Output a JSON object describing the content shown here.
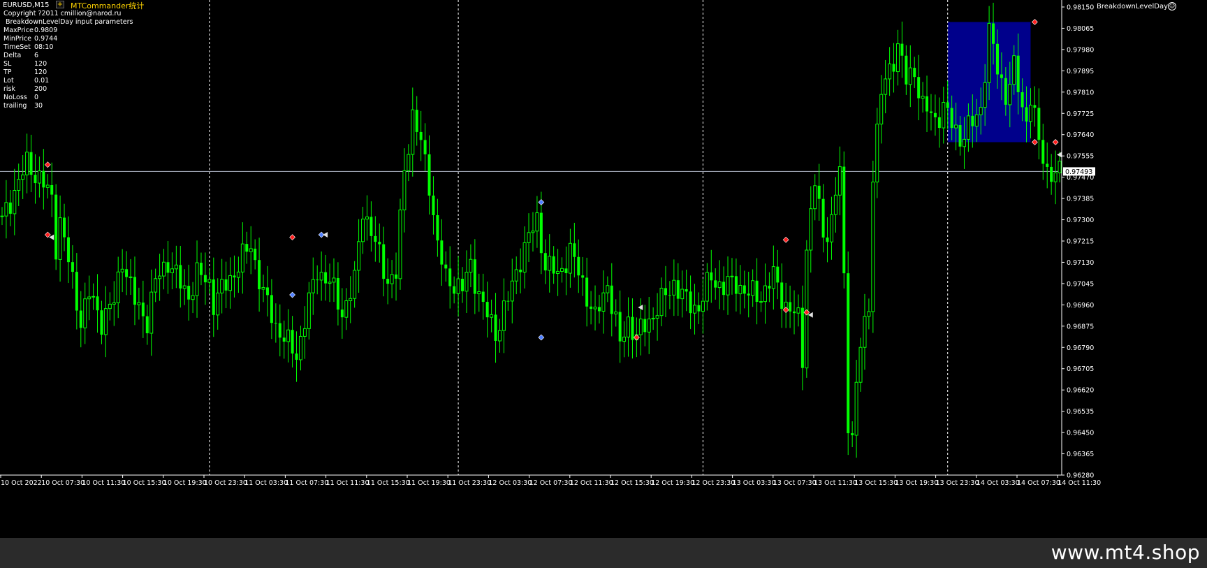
{
  "window": {
    "symbol": "EURUSD,M15",
    "indicator_label": "MTCommander统计",
    "plus_glyph": "+",
    "ea_name": "BreakdownLevelDay",
    "ea_face_glyph": "☺"
  },
  "params": {
    "copyright": "Copyright ?2011 cmillion@narod.ru",
    "header": "BreakdownLevelDay input parameters",
    "rows": [
      {
        "name": "MaxPrice",
        "value": "0.9809"
      },
      {
        "name": "MinPrice",
        "value": "0.9744"
      },
      {
        "name": "TimeSet",
        "value": "08:10"
      },
      {
        "name": "Delta",
        "value": "6"
      },
      {
        "name": "SL",
        "value": "120"
      },
      {
        "name": "TP",
        "value": "120"
      },
      {
        "name": "Lot",
        "value": "0.01"
      },
      {
        "name": "risk",
        "value": "200"
      },
      {
        "name": "NoLoss",
        "value": "0"
      },
      {
        "name": "trailing",
        "value": "30"
      }
    ]
  },
  "watermark": "www.mt4.shop",
  "colors": {
    "background": "#000000",
    "candle": "#00ff00",
    "level_box": "#00008b",
    "bid_line": "#b0b8c8",
    "separator": "#ffffff",
    "axis_text": "#ffffff",
    "sell_marker": "#ff2020",
    "buy_marker": "#5080ff"
  },
  "chart_data": {
    "type": "candlestick",
    "symbol": "EURUSD",
    "timeframe": "M15",
    "y_ticks": [
      "0.98150",
      "0.98065",
      "0.97980",
      "0.97895",
      "0.97810",
      "0.97725",
      "0.97640",
      "0.97555",
      "0.97470",
      "0.97385",
      "0.97300",
      "0.97215",
      "0.97130",
      "0.97045",
      "0.96960",
      "0.96875",
      "0.96790",
      "0.96705",
      "0.96620",
      "0.96535",
      "0.96450",
      "0.96365",
      "0.96280"
    ],
    "ylim": [
      0.9628,
      0.9815
    ],
    "current_price": "0.97493",
    "x_ticks": [
      "10 Oct 2022",
      "10 Oct 07:30",
      "10 Oct 11:30",
      "10 Oct 15:30",
      "10 Oct 19:30",
      "10 Oct 23:30",
      "11 Oct 03:30",
      "11 Oct 07:30",
      "11 Oct 11:30",
      "11 Oct 15:30",
      "11 Oct 19:30",
      "11 Oct 23:30",
      "12 Oct 03:30",
      "12 Oct 07:30",
      "12 Oct 11:30",
      "12 Oct 15:30",
      "12 Oct 19:30",
      "12 Oct 23:30",
      "13 Oct 03:30",
      "13 Oct 07:30",
      "13 Oct 11:30",
      "13 Oct 15:30",
      "13 Oct 19:30",
      "13 Oct 23:30",
      "14 Oct 03:30",
      "14 Oct 07:30",
      "14 Oct 11:30"
    ],
    "day_separators": [
      "10 Oct 23:30",
      "11 Oct 23:30",
      "12 Oct 23:30",
      "13 Oct 23:30"
    ],
    "level_box": {
      "time_from": "14 Oct 00:00",
      "time_to": "14 Oct 08:10",
      "high": 0.9809,
      "low": 0.9761
    },
    "price_path": [
      [
        0,
        0.9729
      ],
      [
        3,
        0.9742
      ],
      [
        6,
        0.9752
      ],
      [
        9,
        0.9747
      ],
      [
        12,
        0.9738
      ],
      [
        13,
        0.972
      ],
      [
        14,
        0.973
      ],
      [
        17,
        0.9705
      ],
      [
        19,
        0.969
      ],
      [
        21,
        0.97
      ],
      [
        24,
        0.969
      ],
      [
        27,
        0.9697
      ],
      [
        29,
        0.9715
      ],
      [
        32,
        0.9697
      ],
      [
        35,
        0.969
      ],
      [
        37,
        0.9705
      ],
      [
        40,
        0.9714
      ],
      [
        43,
        0.9704
      ],
      [
        45,
        0.97
      ],
      [
        47,
        0.9708
      ],
      [
        50,
        0.9705
      ],
      [
        51,
        0.9697
      ],
      [
        54,
        0.9704
      ],
      [
        57,
        0.9712
      ],
      [
        60,
        0.972
      ],
      [
        63,
        0.97
      ],
      [
        66,
        0.9688
      ],
      [
        69,
        0.968
      ],
      [
        71,
        0.9676
      ],
      [
        73,
        0.969
      ],
      [
        76,
        0.971
      ],
      [
        79,
        0.9705
      ],
      [
        82,
        0.9693
      ],
      [
        85,
        0.9705
      ],
      [
        87,
        0.9735
      ],
      [
        90,
        0.972
      ],
      [
        93,
        0.9706
      ],
      [
        95,
        0.9708
      ],
      [
        97,
        0.975
      ],
      [
        99,
        0.9772
      ],
      [
        101,
        0.976
      ],
      [
        103,
        0.9745
      ],
      [
        105,
        0.972
      ],
      [
        107,
        0.9706
      ],
      [
        109,
        0.9705
      ],
      [
        111,
        0.9702
      ],
      [
        113,
        0.9712
      ],
      [
        116,
        0.9695
      ],
      [
        119,
        0.9685
      ],
      [
        122,
        0.9698
      ],
      [
        125,
        0.9715
      ],
      [
        129,
        0.973
      ],
      [
        131,
        0.9712
      ],
      [
        134,
        0.9708
      ],
      [
        137,
        0.9717
      ],
      [
        140,
        0.9705
      ],
      [
        143,
        0.969
      ],
      [
        146,
        0.9705
      ],
      [
        149,
        0.968
      ],
      [
        151,
        0.969
      ],
      [
        153,
        0.9683
      ],
      [
        156,
        0.969
      ],
      [
        159,
        0.9697
      ],
      [
        162,
        0.9705
      ],
      [
        165,
        0.9697
      ],
      [
        168,
        0.9695
      ],
      [
        171,
        0.9707
      ],
      [
        174,
        0.9703
      ],
      [
        177,
        0.9705
      ],
      [
        180,
        0.97
      ],
      [
        183,
        0.97
      ],
      [
        186,
        0.9707
      ],
      [
        189,
        0.9696
      ],
      [
        192,
        0.969
      ],
      [
        193,
        0.9675
      ],
      [
        194,
        0.972
      ],
      [
        196,
        0.9745
      ],
      [
        198,
        0.9723
      ],
      [
        200,
        0.973
      ],
      [
        202,
        0.975
      ],
      [
        203,
        0.9705
      ],
      [
        204,
        0.965
      ],
      [
        205,
        0.9645
      ],
      [
        207,
        0.968
      ],
      [
        209,
        0.9695
      ],
      [
        210,
        0.975
      ],
      [
        212,
        0.978
      ],
      [
        214,
        0.979
      ],
      [
        216,
        0.98
      ],
      [
        218,
        0.9785
      ],
      [
        220,
        0.979
      ],
      [
        222,
        0.9775
      ],
      [
        225,
        0.977
      ],
      [
        227,
        0.9775
      ],
      [
        229,
        0.9768
      ],
      [
        231,
        0.9763
      ],
      [
        234,
        0.9768
      ],
      [
        236,
        0.9775
      ],
      [
        238,
        0.9805
      ],
      [
        240,
        0.979
      ],
      [
        242,
        0.978
      ],
      [
        244,
        0.979
      ],
      [
        246,
        0.9775
      ],
      [
        247,
        0.977
      ],
      [
        248,
        0.978
      ],
      [
        250,
        0.976
      ],
      [
        252,
        0.975
      ],
      [
        254,
        0.9748
      ]
    ],
    "total_bars": 256,
    "markers": [
      {
        "bar": 11,
        "price": 0.9752,
        "kind": "sell"
      },
      {
        "bar": 11,
        "price": 0.9724,
        "kind": "sell"
      },
      {
        "bar": 12,
        "price": 0.9723,
        "kind": "close"
      },
      {
        "bar": 70,
        "price": 0.9723,
        "kind": "sell"
      },
      {
        "bar": 70,
        "price": 0.97,
        "kind": "buy"
      },
      {
        "bar": 77,
        "price": 0.9724,
        "kind": "buy"
      },
      {
        "bar": 78,
        "price": 0.9724,
        "kind": "close"
      },
      {
        "bar": 130,
        "price": 0.9737,
        "kind": "buy"
      },
      {
        "bar": 130,
        "price": 0.9683,
        "kind": "buy"
      },
      {
        "bar": 153,
        "price": 0.9683,
        "kind": "sell"
      },
      {
        "bar": 154,
        "price": 0.9695,
        "kind": "close"
      },
      {
        "bar": 189,
        "price": 0.9722,
        "kind": "sell"
      },
      {
        "bar": 189,
        "price": 0.9694,
        "kind": "sell"
      },
      {
        "bar": 194,
        "price": 0.9693,
        "kind": "sell"
      },
      {
        "bar": 195,
        "price": 0.9692,
        "kind": "close"
      },
      {
        "bar": 249,
        "price": 0.9809,
        "kind": "sell"
      },
      {
        "bar": 249,
        "price": 0.9761,
        "kind": "sell"
      },
      {
        "bar": 254,
        "price": 0.9761,
        "kind": "sell"
      },
      {
        "bar": 255,
        "price": 0.9756,
        "kind": "close"
      }
    ]
  }
}
